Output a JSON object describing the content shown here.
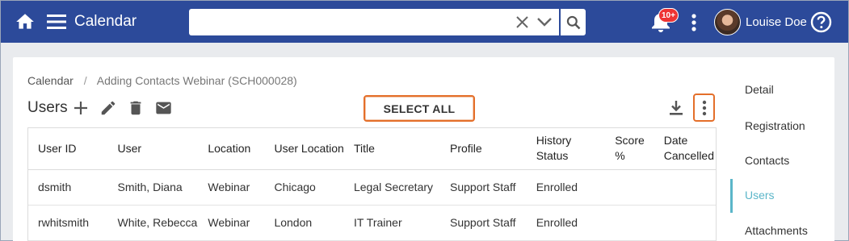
{
  "header": {
    "app_title": "Calendar",
    "search_value": "",
    "notification_badge": "10+",
    "user_name": "Louise Doe",
    "colors": {
      "bar": "#2c4a9a",
      "badge": "#e33333"
    }
  },
  "breadcrumb": {
    "root": "Calendar",
    "separator": "/",
    "current": "Adding Contacts Webinar (SCH000028)"
  },
  "toolbar": {
    "title": "Users",
    "select_all_label": "SELECT ALL",
    "icons": [
      "add-icon",
      "edit-icon",
      "delete-icon",
      "email-icon",
      "download-icon",
      "more-vert-icon"
    ],
    "highlight_color": "#e46f2a"
  },
  "table": {
    "columns": [
      "User ID",
      "User",
      "Location",
      "User Location",
      "Title",
      "Profile",
      "History Status",
      "Score %",
      "Date Cancelled"
    ],
    "rows": [
      {
        "user_id": "dsmith",
        "user": "Smith, Diana",
        "location": "Webinar",
        "user_location": "Chicago",
        "title": "Legal Secretary",
        "profile": "Support Staff",
        "status": "Enrolled",
        "score": "",
        "date_cancelled": ""
      },
      {
        "user_id": "rwhitsmith",
        "user": "White, Rebecca",
        "location": "Webinar",
        "user_location": "London",
        "title": "IT Trainer",
        "profile": "Support Staff",
        "status": "Enrolled",
        "score": "",
        "date_cancelled": ""
      }
    ]
  },
  "sidenav": {
    "items": [
      {
        "label": "Detail"
      },
      {
        "label": "Registration"
      },
      {
        "label": "Contacts"
      },
      {
        "label": "Users",
        "active": true
      },
      {
        "label": "Attachments"
      }
    ],
    "active_color": "#5bb6c9"
  }
}
